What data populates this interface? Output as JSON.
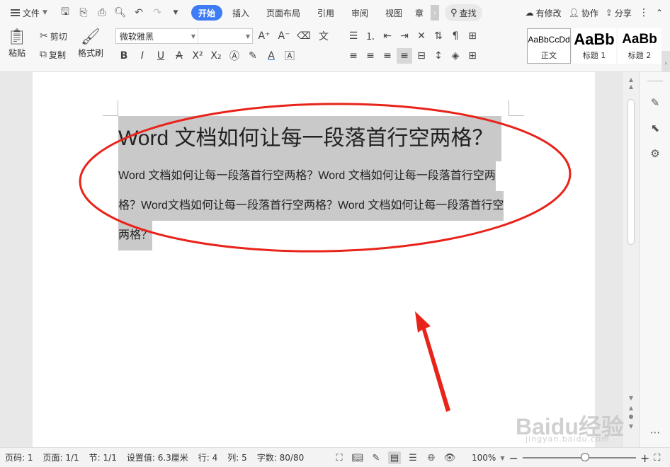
{
  "topbar": {
    "file_menu": "文件",
    "tabs": [
      {
        "label": "开始",
        "active": true
      },
      {
        "label": "插入",
        "active": false
      },
      {
        "label": "页面布局",
        "active": false
      },
      {
        "label": "引用",
        "active": false
      },
      {
        "label": "审阅",
        "active": false
      },
      {
        "label": "视图",
        "active": false
      },
      {
        "label": "章",
        "active": false
      }
    ],
    "search_label": "查找",
    "actions": {
      "revise": "有修改",
      "collab": "协作",
      "share": "分享"
    }
  },
  "ribbon": {
    "paste": "粘贴",
    "cut": "剪切",
    "copy": "复制",
    "format_painter": "格式刷",
    "font_name": "微软雅黑",
    "font_size": "",
    "styles": [
      {
        "preview": "AaBbCcDd",
        "label": "正文",
        "selected": true
      },
      {
        "preview": "AaBb",
        "label": "标题 1",
        "selected": false
      },
      {
        "preview": "AaBb",
        "label": "标题 2",
        "selected": false
      }
    ]
  },
  "document": {
    "title": "Word 文档如何让每一段落首行空两格？",
    "body_lines": [
      "Word 文档如何让每一段落首行空两格？Word 文档如何让每一段落首行空两",
      "格？Word文档如何让每一段落首行空两格？Word 文档如何让每一段落首行空",
      "两格？"
    ]
  },
  "watermark": {
    "main": "Baidu经验",
    "sub": "jingyan.baidu.com"
  },
  "statusbar": {
    "page_code": "页码: 1",
    "page": "页面: 1/1",
    "section": "节: 1/1",
    "setting": "设置值: 6.3厘米",
    "row": "行: 4",
    "col": "列: 5",
    "wordcount": "字数: 80/80",
    "zoom": "100%",
    "zoom_level": 0.55
  },
  "colors": {
    "accent": "#3e7cf5",
    "annotation": "#e8231a",
    "selection": "#c9c9c9"
  }
}
